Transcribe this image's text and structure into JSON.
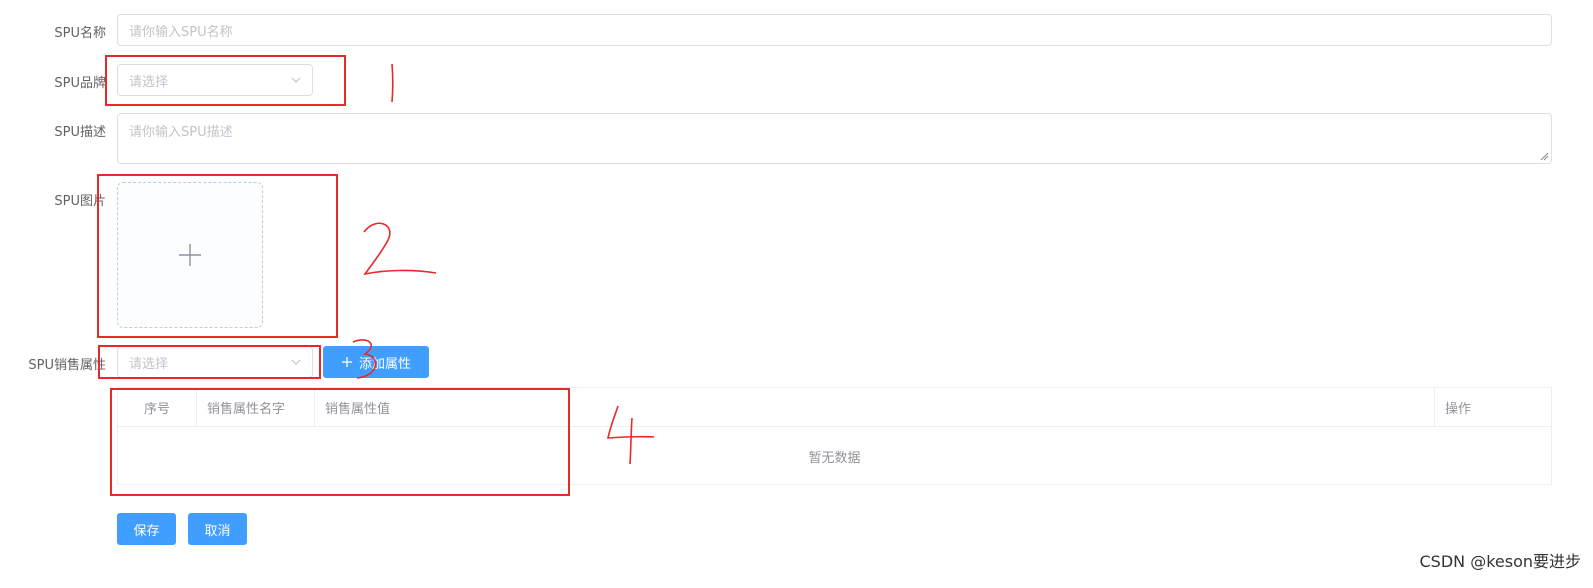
{
  "form": {
    "name": {
      "label": "SPU名称",
      "placeholder": "请你输入SPU名称"
    },
    "brand": {
      "label": "SPU品牌",
      "placeholder": "请选择"
    },
    "desc": {
      "label": "SPU描述",
      "placeholder": "请你输入SPU描述"
    },
    "image": {
      "label": "SPU图片"
    },
    "sale_attr": {
      "label": "SPU销售属性",
      "placeholder": "请选择",
      "add_button": "添加属性"
    }
  },
  "table": {
    "headers": [
      "序号",
      "销售属性名字",
      "销售属性值",
      "操作"
    ],
    "empty_text": "暂无数据"
  },
  "actions": {
    "save": "保存",
    "cancel": "取消"
  },
  "watermark": "CSDN @keson要进步",
  "colors": {
    "primary": "#409eff",
    "annotation": "#e8292c"
  }
}
